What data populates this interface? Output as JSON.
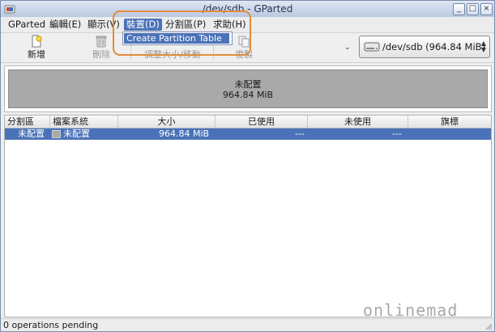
{
  "window": {
    "title": "/dev/sdb - GParted",
    "minimize_glyph": "_",
    "maximize_glyph": "□",
    "close_glyph": "×"
  },
  "menubar": {
    "items": [
      {
        "label": "GParted"
      },
      {
        "label": "編輯(E)"
      },
      {
        "label": "顯示(V)"
      },
      {
        "label": "裝置(D)"
      },
      {
        "label": "分割區(P)"
      },
      {
        "label": "求助(H)"
      }
    ],
    "active_index": 3,
    "open_menu": {
      "items": [
        {
          "label": "Create Partition Table ..."
        }
      ]
    }
  },
  "toolbar": {
    "new_label": "新增",
    "delete_label": "刪除",
    "resize_label": "調整大小/移動",
    "copy_label": "複製",
    "overflow_glyph": "⌄",
    "device": {
      "label": "/dev/sdb  (964.84 MiB)",
      "icon": "hard-disk-icon"
    }
  },
  "graph": {
    "label": "未配置",
    "size": "964.84 MiB",
    "color": "#a9a9a9"
  },
  "table": {
    "columns": [
      "分割區",
      "檔案系統",
      "大小",
      "已使用",
      "未使用",
      "旗標"
    ],
    "rows": [
      {
        "partition": "未配置",
        "filesystem": "未配置",
        "size": "964.84 MiB",
        "used": "---",
        "unused": "---",
        "flags": ""
      }
    ]
  },
  "watermark": "onlinemad",
  "status": {
    "text": "0 operations pending"
  },
  "colors": {
    "selection": "#4a72b8",
    "highlight": "#e38b3c",
    "unallocated": "#a9a9a9"
  }
}
